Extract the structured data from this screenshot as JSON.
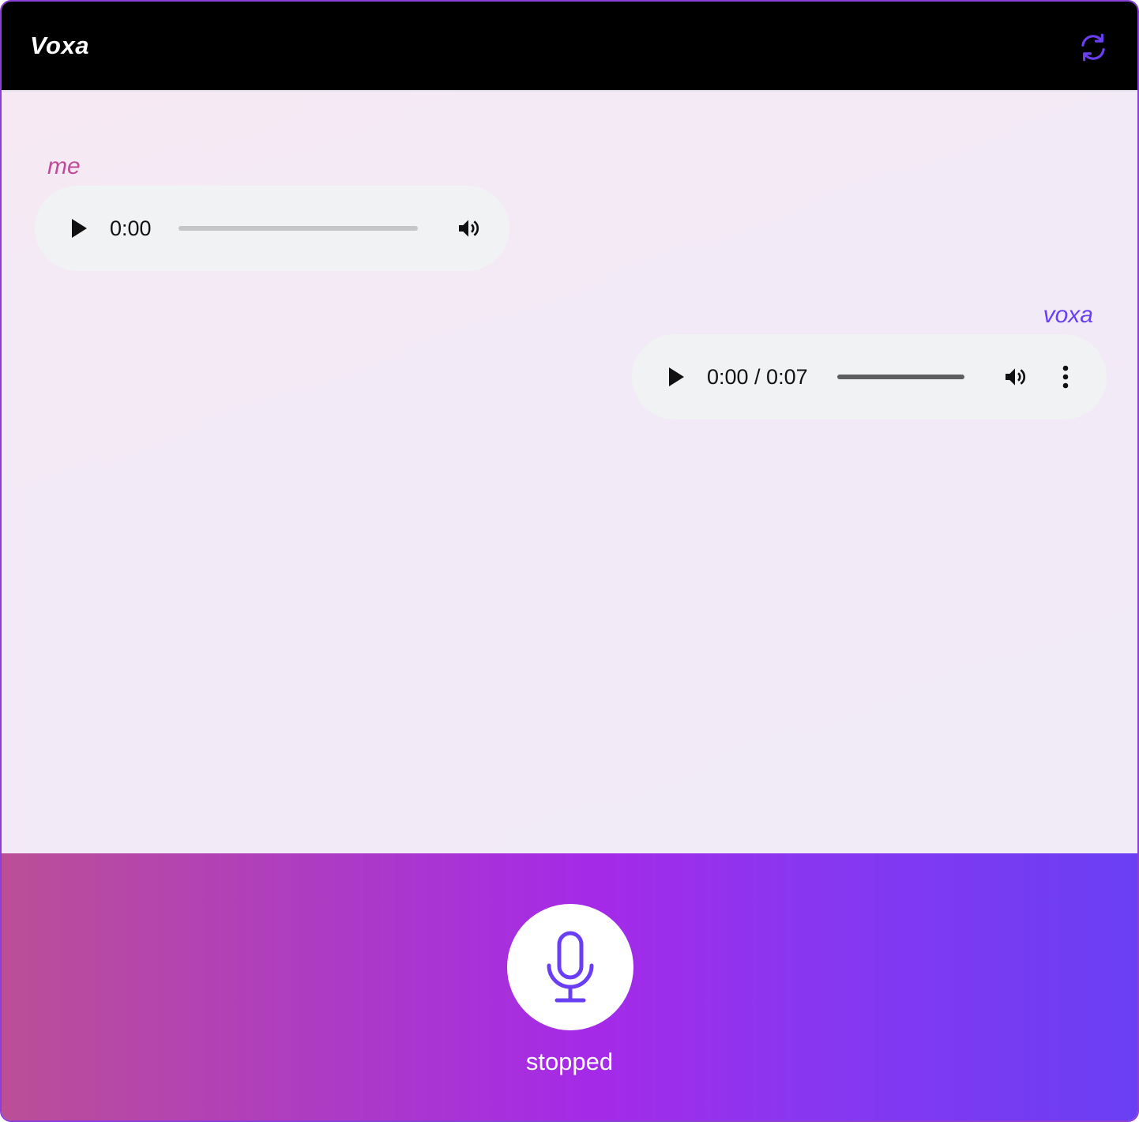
{
  "header": {
    "title": "Voxa",
    "refresh_icon": "refresh-icon"
  },
  "colors": {
    "accent": "#6a3ff4",
    "me_label": "#c04a9a",
    "voxa_label": "#6a3ff4",
    "header_bg": "#000000",
    "gradient_start": "#bb4f96",
    "gradient_end": "#6a3ff4"
  },
  "messages": [
    {
      "speaker": "me",
      "time_text": "0:00",
      "progress": 0,
      "icons": [
        "play-icon",
        "volume-icon"
      ]
    },
    {
      "speaker": "voxa",
      "time_text": "0:00 / 0:07",
      "progress": 0,
      "icons": [
        "play-icon",
        "volume-icon",
        "more-options-icon"
      ]
    }
  ],
  "footer": {
    "status": "stopped",
    "mic_icon": "microphone-icon"
  }
}
